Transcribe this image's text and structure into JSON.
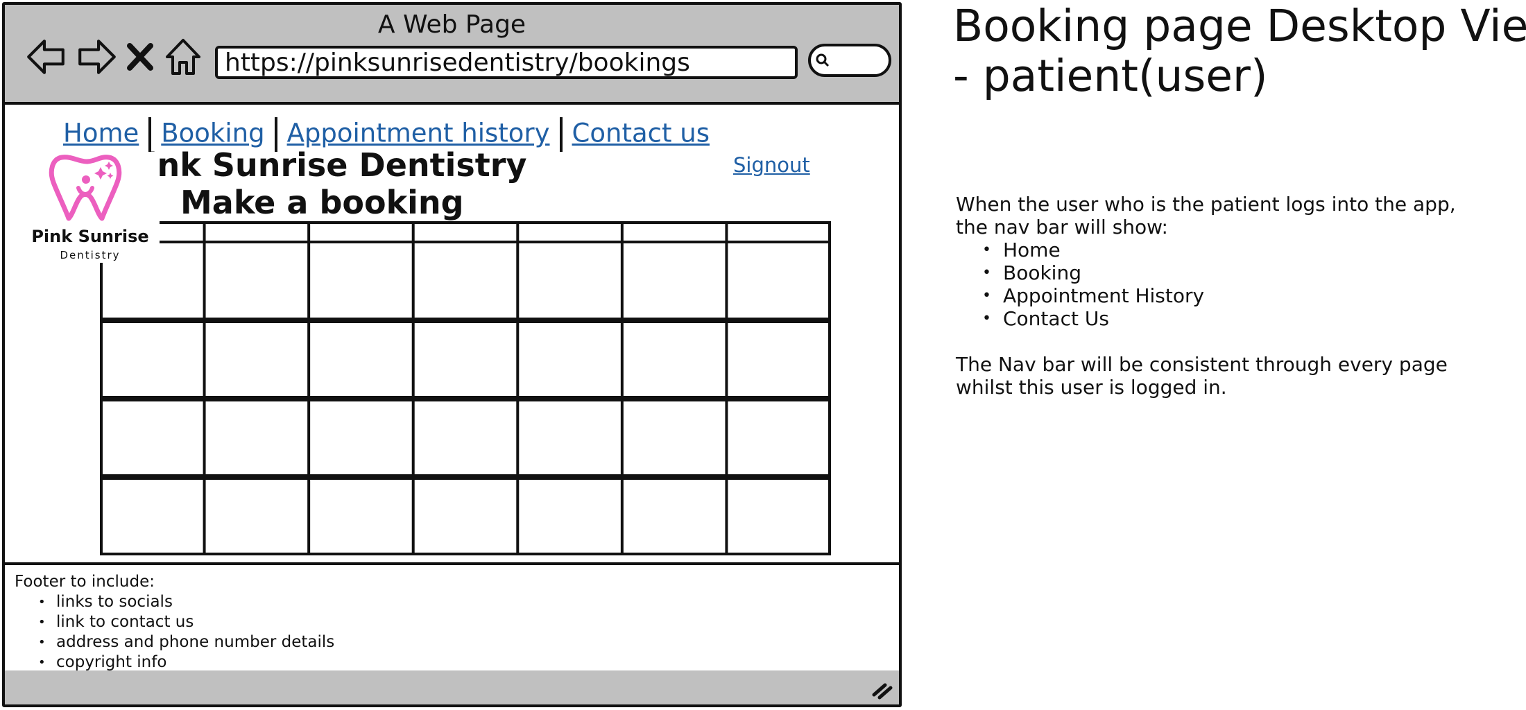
{
  "browser": {
    "window_title": "A Web Page",
    "url": "https://pinksunrisedentistry/bookings"
  },
  "site": {
    "nav": [
      "Home",
      "Booking",
      "Appointment history",
      "Contact us"
    ],
    "signout_label": "Signout",
    "brand_title": "Pink Sunrise Dentistry",
    "page_heading": "Make a booking",
    "logo": {
      "name": "Pink Sunrise",
      "sub": "Dentistry",
      "color": "#ec5fbf"
    },
    "booking_grid": {
      "columns": 7,
      "rows": 4
    }
  },
  "footer": {
    "heading": "Footer to include:",
    "items": [
      "links to socials",
      "link to contact us",
      "address and phone number details",
      "copyright info"
    ]
  },
  "annotation": {
    "title_line1": "Booking page Desktop View",
    "title_line2": "- patient(user)",
    "intro_line1": "When the user who is the patient logs into the app,",
    "intro_line2": "the nav bar will show:",
    "nav_items": [
      "Home",
      "Booking",
      "Appointment History",
      "Contact Us"
    ],
    "outro_line1": "The Nav bar will be consistent through every page",
    "outro_line2": "whilst this user is logged in."
  }
}
